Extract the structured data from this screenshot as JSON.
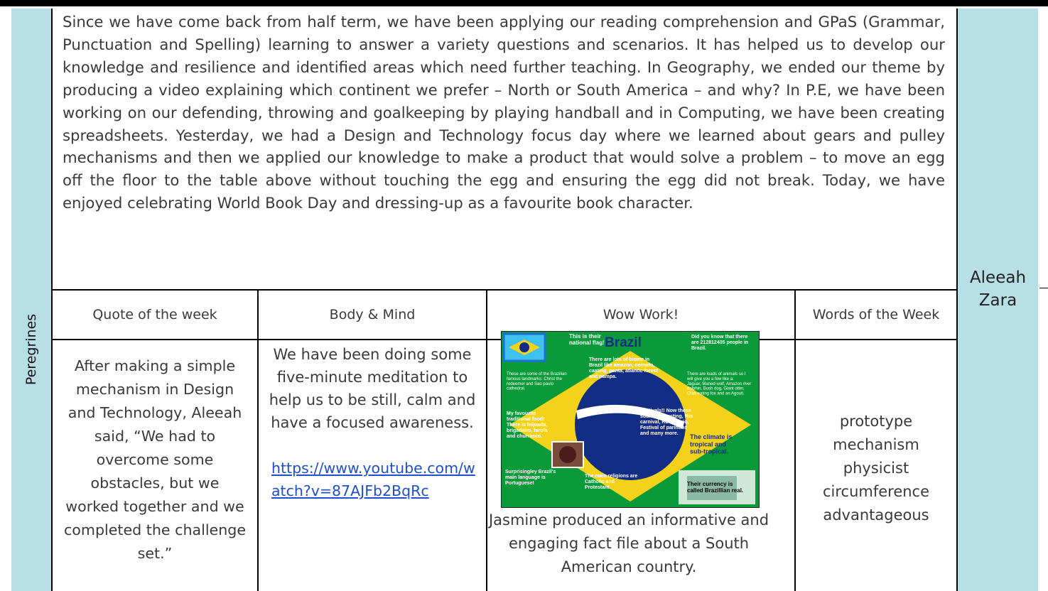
{
  "class_name": "Peregrines",
  "intro_text": "Since we have come back from half term, we have been applying our reading comprehension and GPaS (Grammar, Punctuation and Spelling) learning to answer a variety questions and scenarios. It has helped us to develop our knowledge and resilience and identified areas which need further teaching. In Geography, we ended our theme by producing a video explaining which continent we prefer – North or South America – and why? In P.E, we have been working on our defending, throwing and goalkeeping by playing handball and in Computing, we have been creating spreadsheets. Yesterday, we had a Design and Technology focus day where we learned about gears and pulley mechanisms and then we applied our knowledge to make a product that would solve a problem – to move an egg off the floor to the table above without touching the egg and ensuring the egg did not break. Today, we have enjoyed celebrating World Book Day and dressing-up as a favourite book character.",
  "headers": {
    "quote": "Quote of the week",
    "body_mind": "Body & Mind",
    "wow": "Wow Work!",
    "words": "Words of the Week"
  },
  "quote_text": "After making a simple mechanism in Design and Technology, Aleeah said, “We had to overcome some obstacles, but we worked together and we completed the challenge set.”",
  "body_mind": {
    "text": "We have been doing some five-minute meditation to help us to be still, calm and have a focused awareness.",
    "link": "https://www.youtube.com/watch?v=87AJFb2BqRc"
  },
  "wow": {
    "caption": "Jasmine produced an informative and engaging fact file about a South American country.",
    "poster": {
      "title": "Brazil",
      "flag_note": "This is their national flag!",
      "did_you_know": "Did you know that there are 212812405 people in Brazil.",
      "biome": "There are lots of biome in Brazil like amazon, cerrado, caating, panta, atlantic forest and pampa.",
      "landmarks": "These are some of the Brazilian famous landmarks: Christ the redeemer and Sao paulo cathedral.",
      "animals": "There are loads of animals so I will give you a few like a: Jaguar, Maned wolf, Amazon river dolphin, Bush dog, Giant otter, Crab eating fox and an Agouti.",
      "food": "My favourite traditional food! There is feijoada, brigadeiro, farofa and churrasco.",
      "festivals": "Festivals!! Now these sound interesting, Rio carnival, Rock in rio, Festival of parintins and many more.",
      "climate": "The climate is tropical and sub-tropical.",
      "language": "Surprisingley Brazil's main language is Portuguese!",
      "religions": "The main religions are Catholic and Protestant.",
      "currency": "Their currency is called Brazillian real."
    }
  },
  "words_of_week": [
    "prototype",
    "mechanism",
    "physicist",
    "circumference",
    "advantageous"
  ],
  "names": [
    "Aleeah",
    "Zara"
  ],
  "colors": {
    "panel": "#b8dfe6",
    "link": "#1f4fd0",
    "border": "#000000"
  }
}
